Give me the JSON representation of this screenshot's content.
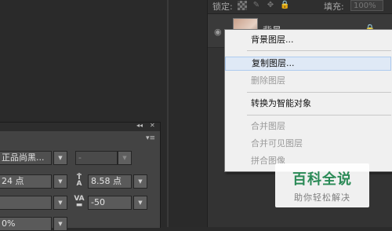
{
  "layers_panel": {
    "lock_label": "锁定:",
    "fill_label": "填充:",
    "fill_value": "100%",
    "layer": {
      "name": "背景"
    }
  },
  "context_menu": {
    "items": [
      {
        "label": "背景图层...",
        "disabled": false
      },
      {
        "label": "复制图层...",
        "disabled": false,
        "hovered": true
      },
      {
        "label": "删除图层",
        "disabled": true
      },
      {
        "label": "转换为智能对象",
        "disabled": false
      },
      {
        "label": "合并图层",
        "disabled": true
      },
      {
        "label": "合并可见图层",
        "disabled": true
      },
      {
        "label": "拼合图像",
        "disabled": true
      }
    ]
  },
  "character_panel": {
    "font_family": "正品尚黑...",
    "font_style": "-",
    "font_size": "24 点",
    "leading": "8.58 点",
    "tracking": "-50",
    "scale": "0%"
  },
  "watermark": {
    "title": "百科全说",
    "subtitle": "助你轻松解决"
  }
}
